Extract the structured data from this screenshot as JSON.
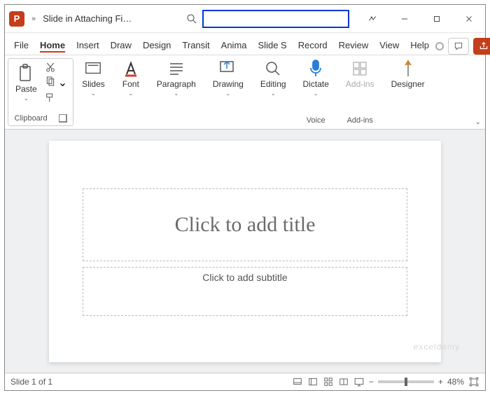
{
  "app_icon_letter": "P",
  "titlebar": {
    "chevrons": "»",
    "doc_title": "Slide in Attaching Fi…"
  },
  "tabs": [
    "File",
    "Home",
    "Insert",
    "Draw",
    "Design",
    "Transit",
    "Anima",
    "Slide S",
    "Record",
    "Review",
    "View",
    "Help"
  ],
  "active_tab_index": 1,
  "ribbon": {
    "clipboard_label": "Clipboard",
    "paste": "Paste",
    "slides": "Slides",
    "font": "Font",
    "paragraph": "Paragraph",
    "drawing": "Drawing",
    "editing": "Editing",
    "dictate": "Dictate",
    "voice_label": "Voice",
    "addins": "Add-ins",
    "addins_label": "Add-ins",
    "designer": "Designer"
  },
  "slide": {
    "title_placeholder": "Click to add title",
    "subtitle_placeholder": "Click to add subtitle"
  },
  "watermark": "exceldemy",
  "statusbar": {
    "slide_info": "Slide 1 of 1",
    "zoom_minus": "−",
    "zoom_plus": "+",
    "zoom": "48%"
  }
}
